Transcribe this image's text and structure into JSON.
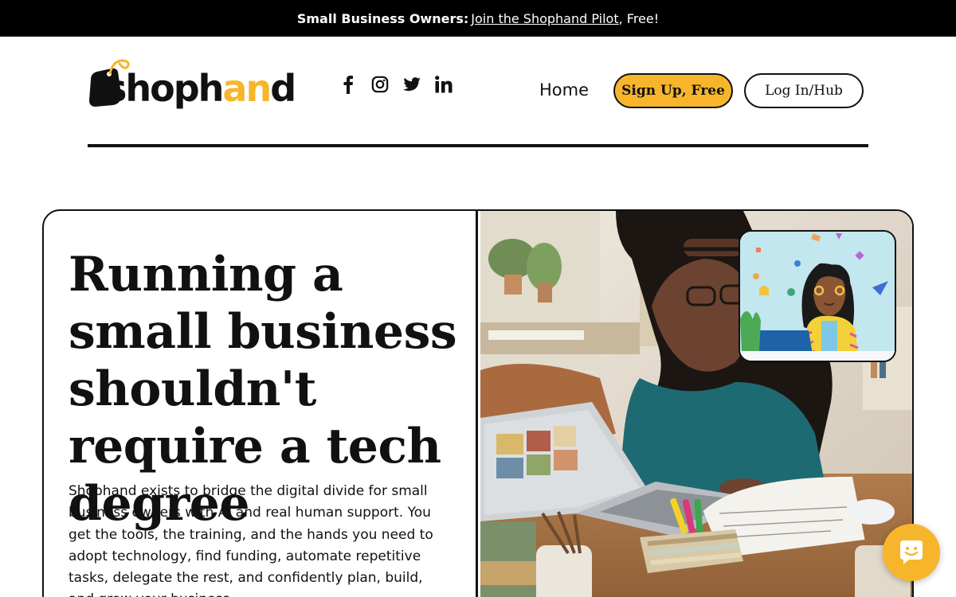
{
  "promo": {
    "lead": "Small Business Owners:",
    "link": "Join the Shophand Pilot",
    "tail": ", Free!"
  },
  "brand": {
    "name_prefix": "shoph",
    "name_accent": "an",
    "name_suffix": "d",
    "accent_color": "#f7b52b"
  },
  "social": [
    "facebook-icon",
    "instagram-icon",
    "twitter-icon",
    "linkedin-icon"
  ],
  "nav": {
    "home": "Home",
    "signup": "Sign Up, Free",
    "login": "Log In/Hub"
  },
  "hero": {
    "title": "Running a small business shouldn't require a tech degree",
    "body": "Shophand exists to bridge the digital divide for small business owners with AI and real human support. You get the tools, the training, and the hands you need to adopt technology, find funding, automate repetitive tasks, delegate the rest, and confidently plan, build, and grow your business."
  },
  "chat": {
    "icon": "chat-icon"
  }
}
